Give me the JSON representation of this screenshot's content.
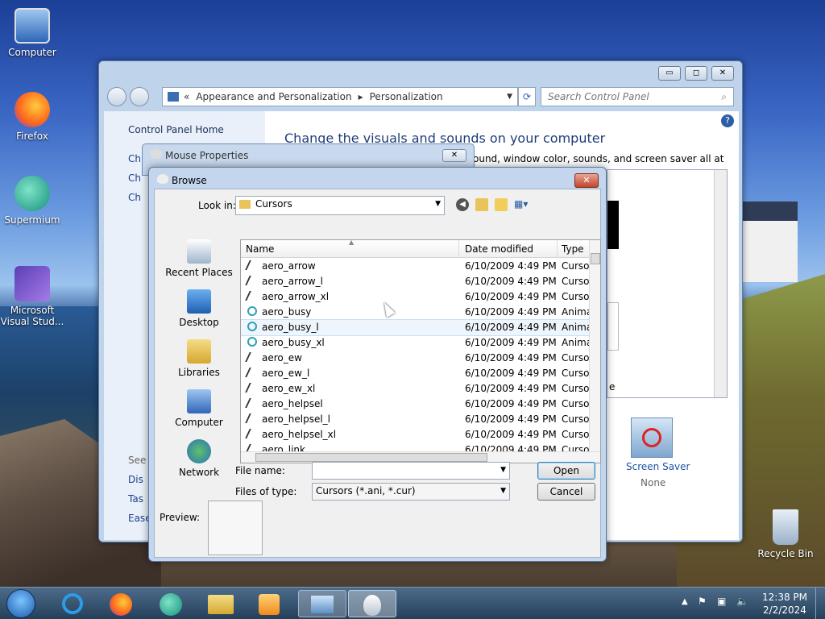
{
  "desktop": {
    "icons": [
      {
        "name": "computer",
        "label": "Computer"
      },
      {
        "name": "firefox",
        "label": "Firefox"
      },
      {
        "name": "supermium",
        "label": "Supermium"
      },
      {
        "name": "vs",
        "label": "Microsoft Visual Stud..."
      }
    ],
    "recycle": "Recycle Bin"
  },
  "cp": {
    "path_prefix": "«",
    "crumb1": "Appearance and Personalization",
    "sep": "▸",
    "crumb2": "Personalization",
    "search_placeholder": "Search Control Panel",
    "home": "Control Panel Home",
    "left_links": [
      "Ch",
      "Ch",
      "Ch"
    ],
    "bottom_links": [
      "See",
      "Dis",
      "Tas",
      "Ease"
    ],
    "heading": "Change the visuals and sounds on your computer",
    "desc": "ound, window color, sounds, and screen saver all at once.",
    "screen_saver": "Screen Saver",
    "screen_saver_value": "None",
    "letter_e": "e"
  },
  "mouse": {
    "title": "Mouse Properties"
  },
  "browse": {
    "title": "Browse",
    "lookin_label": "Look in:",
    "lookin_value": "Cursors",
    "places": [
      {
        "label": "Recent Places"
      },
      {
        "label": "Desktop"
      },
      {
        "label": "Libraries"
      },
      {
        "label": "Computer"
      },
      {
        "label": "Network"
      }
    ],
    "columns": {
      "name": "Name",
      "date": "Date modified",
      "type": "Type"
    },
    "files": [
      {
        "name": "aero_arrow",
        "date": "6/10/2009 4:49 PM",
        "type": "Cursor"
      },
      {
        "name": "aero_arrow_l",
        "date": "6/10/2009 4:49 PM",
        "type": "Cursor"
      },
      {
        "name": "aero_arrow_xl",
        "date": "6/10/2009 4:49 PM",
        "type": "Cursor"
      },
      {
        "name": "aero_busy",
        "date": "6/10/2009 4:49 PM",
        "type": "Anima"
      },
      {
        "name": "aero_busy_l",
        "date": "6/10/2009 4:49 PM",
        "type": "Anima"
      },
      {
        "name": "aero_busy_xl",
        "date": "6/10/2009 4:49 PM",
        "type": "Anima"
      },
      {
        "name": "aero_ew",
        "date": "6/10/2009 4:49 PM",
        "type": "Cursor"
      },
      {
        "name": "aero_ew_l",
        "date": "6/10/2009 4:49 PM",
        "type": "Cursor"
      },
      {
        "name": "aero_ew_xl",
        "date": "6/10/2009 4:49 PM",
        "type": "Cursor"
      },
      {
        "name": "aero_helpsel",
        "date": "6/10/2009 4:49 PM",
        "type": "Cursor"
      },
      {
        "name": "aero_helpsel_l",
        "date": "6/10/2009 4:49 PM",
        "type": "Cursor"
      },
      {
        "name": "aero_helpsel_xl",
        "date": "6/10/2009 4:49 PM",
        "type": "Cursor"
      },
      {
        "name": "aero_link",
        "date": "6/10/2009 4:49 PM",
        "type": "Cursor"
      }
    ],
    "filename_label": "File name:",
    "filename_value": "",
    "filetype_label": "Files of type:",
    "filetype_value": "Cursors (*.ani, *.cur)",
    "open": "Open",
    "cancel": "Cancel",
    "preview": "Preview:"
  },
  "taskbar": {
    "time": "12:38 PM",
    "date": "2/2/2024"
  }
}
